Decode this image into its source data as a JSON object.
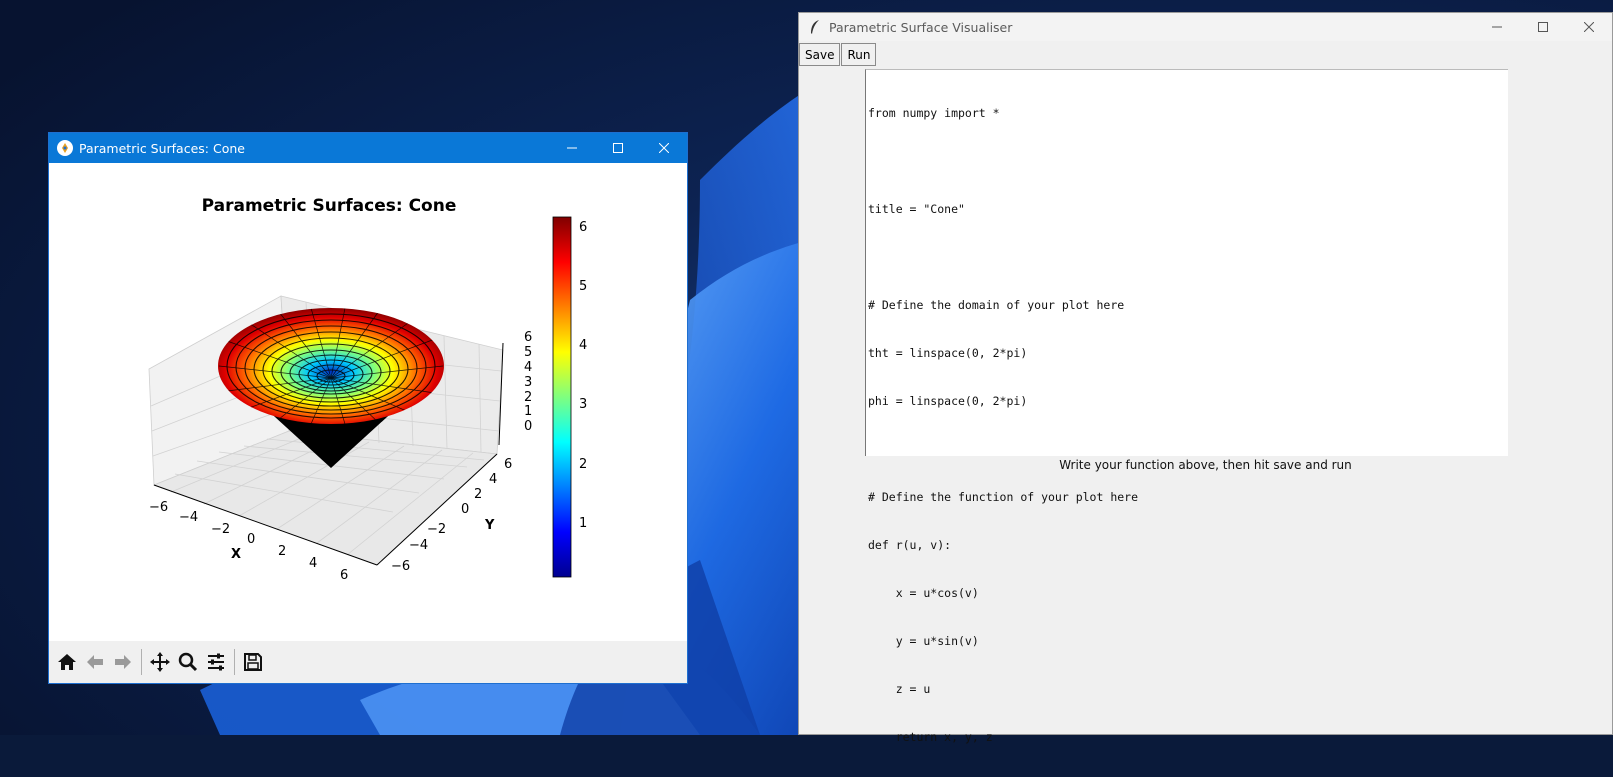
{
  "editor": {
    "title": "Parametric Surface Visualiser",
    "buttons": {
      "save": "Save",
      "run": "Run"
    },
    "code_lines": [
      "from numpy import *",
      "",
      "title = \"Cone\"",
      "",
      "# Define the domain of your plot here",
      "tht = linspace(0, 2*pi)",
      "phi = linspace(0, 2*pi)",
      "",
      "# Define the function of your plot here",
      "def r(u, v):",
      "    x = u*cos(v)",
      "    y = u*sin(v)",
      "    z = u",
      "    return x, y, z"
    ],
    "status": "Write your function above, then hit save and run"
  },
  "plot_window": {
    "title": "Parametric Surfaces: Cone",
    "figure_title": "Parametric Surfaces: Cone",
    "x_label": "X",
    "y_label": "Y",
    "x_ticks": [
      "−6",
      "−4",
      "−2",
      "0",
      "2",
      "4",
      "6"
    ],
    "y_ticks": [
      "−6",
      "−4",
      "−2",
      "0",
      "2",
      "4",
      "6"
    ],
    "z_ticks": [
      "0",
      "1",
      "2",
      "3",
      "4",
      "5",
      "6"
    ],
    "colorbar_ticks": [
      "1",
      "2",
      "3",
      "4",
      "5",
      "6"
    ],
    "toolbar_icons": [
      "home-icon",
      "back-arrow-icon",
      "forward-arrow-icon",
      "pan-icon",
      "zoom-icon",
      "configure-subplots-icon",
      "save-figure-icon"
    ]
  },
  "chart_data": {
    "type": "surface-3d",
    "title": "Parametric Surfaces: Cone",
    "xlabel": "X",
    "ylabel": "Y",
    "zlabel": "",
    "xlim": [
      -6.28,
      6.28
    ],
    "ylim": [
      -6.28,
      6.28
    ],
    "zlim": [
      0,
      6.28
    ],
    "colormap": "jet",
    "colorbar_range": [
      0,
      6.28
    ],
    "colors": {
      "low": "#00008f",
      "mid": "#7fff7f",
      "high": "#800000"
    }
  }
}
